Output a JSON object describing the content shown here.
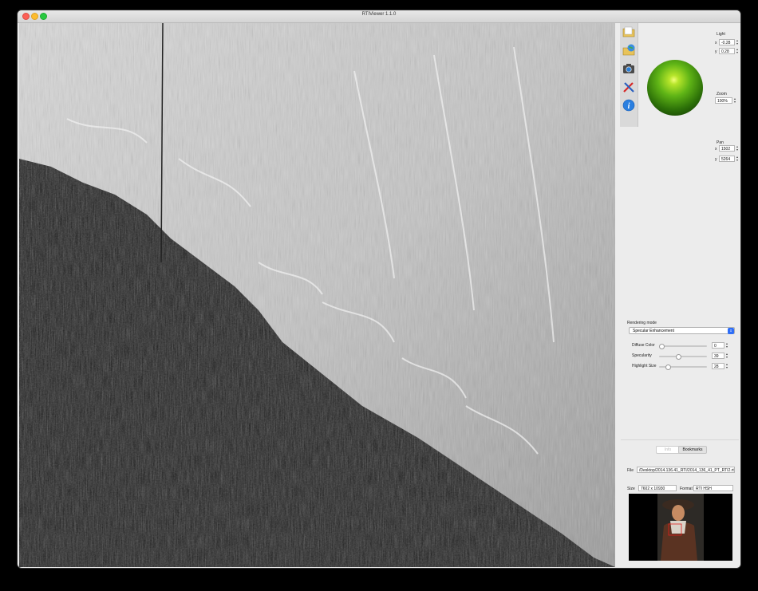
{
  "window": {
    "title": "RTIViewer 1.1.0"
  },
  "light": {
    "label": "Light",
    "x_label": "x",
    "x_value": "-0.28",
    "y_label": "y",
    "y_value": "0.28"
  },
  "zoom": {
    "label": "Zoom",
    "value": "100%"
  },
  "pan": {
    "label": "Pan",
    "x_label": "x",
    "x_value": "1502",
    "y_label": "y",
    "y_value": "5264"
  },
  "rendering": {
    "label": "Rendering mode",
    "mode": "Specular Enhancement",
    "params": [
      {
        "label": "Diffuse Color",
        "value": "0",
        "fraction": 0.0
      },
      {
        "label": "Specularity",
        "value": "39",
        "fraction": 0.39
      },
      {
        "label": "Highlight Size",
        "value": "28",
        "fraction": 0.14
      }
    ]
  },
  "tabs": {
    "info": "Info",
    "bookmarks": "Bookmarks"
  },
  "file": {
    "label": "File",
    "value": "/Desktop/2014.136.41_RTI/2014_136_41_PT_RTI2.rti"
  },
  "size": {
    "label": "Size",
    "value": "7602 x 10930"
  },
  "format": {
    "label": "Format",
    "value": "RTI HSH"
  },
  "colors": {
    "sphere": "#5fb416",
    "select_accent": "#2e6ef7",
    "roi": "#e02020"
  },
  "icons": [
    "open-file-icon",
    "open-remote-icon",
    "snapshot-icon",
    "settings-icon",
    "info-icon"
  ]
}
